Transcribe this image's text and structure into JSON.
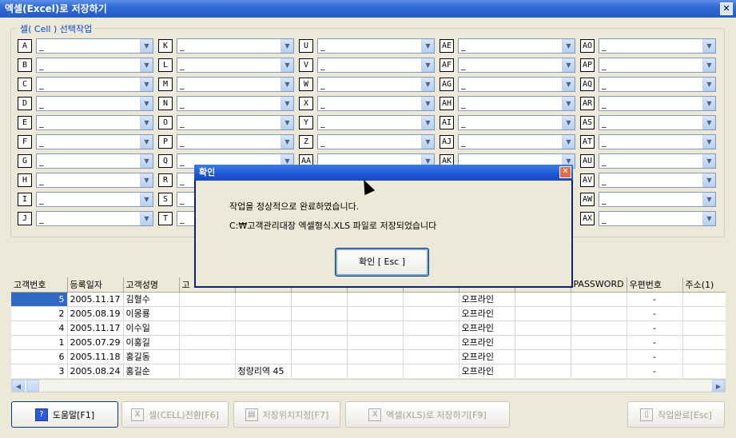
{
  "window": {
    "title": "엑셀(Excel)로 저장하기",
    "close": "✕"
  },
  "group": {
    "title": "셀( Cell ) 선택작업"
  },
  "columns": [
    [
      "A",
      "B",
      "C",
      "D",
      "E",
      "F",
      "G",
      "H",
      "I",
      "J"
    ],
    [
      "K",
      "L",
      "M",
      "N",
      "O",
      "P",
      "Q",
      "R",
      "S",
      "T"
    ],
    [
      "U",
      "V",
      "W",
      "X",
      "Y",
      "Z",
      "AA",
      "",
      "",
      ""
    ],
    [
      "AE",
      "AF",
      "AG",
      "AH",
      "AI",
      "AJ",
      "AK",
      "",
      "",
      ""
    ],
    [
      "AO",
      "AP",
      "AQ",
      "AR",
      "AS",
      "AT",
      "AU",
      "AV",
      "AW",
      "AX"
    ]
  ],
  "combo_value": "_",
  "table": {
    "headers": [
      "고객번호",
      "등록일자",
      "고객성명",
      "고",
      "",
      "",
      "",
      "",
      "",
      "",
      "PASSWORD",
      "우편번호",
      "주소(1)"
    ],
    "rows": [
      [
        "5",
        "2005.11.17",
        "김혈수",
        "",
        "",
        "",
        "",
        "",
        "오프라인",
        "",
        "",
        "-",
        ""
      ],
      [
        "2",
        "2005.08.19",
        "이몽룡",
        "",
        "",
        "",
        "",
        "",
        "오프라인",
        "",
        "",
        "-",
        ""
      ],
      [
        "4",
        "2005.11.17",
        "이수일",
        "",
        "",
        "",
        "",
        "",
        "오프라인",
        "",
        "",
        "-",
        ""
      ],
      [
        "1",
        "2005.07.29",
        "이홍길",
        "",
        "",
        "",
        "",
        "",
        "오프라인",
        "",
        "",
        "-",
        ""
      ],
      [
        "6",
        "2005.11.18",
        "홍길동",
        "",
        "",
        "",
        "",
        "",
        "오프라인",
        "",
        "",
        "-",
        ""
      ],
      [
        "3",
        "2005.08.24",
        "홍길순",
        "",
        "청량리역 45",
        "",
        "",
        "",
        "오프라인",
        "",
        "",
        "-",
        ""
      ]
    ]
  },
  "buttons": {
    "help": "도움말[F1]",
    "cell_convert": "셀(CELL)전환[F6]",
    "save_location": "저장위치지정[F7]",
    "save_xls": "엑셀(XLS)로 저장하기[F9]",
    "done": "작업완료[Esc]"
  },
  "modal": {
    "title": "확인",
    "line1": "작업을 정상적으로 완료하였습니다.",
    "line2": "C:₩고객관리대장 엑셀형식.XLS 파일로 저장되었습니다",
    "ok": "확인 [ Esc ]"
  }
}
